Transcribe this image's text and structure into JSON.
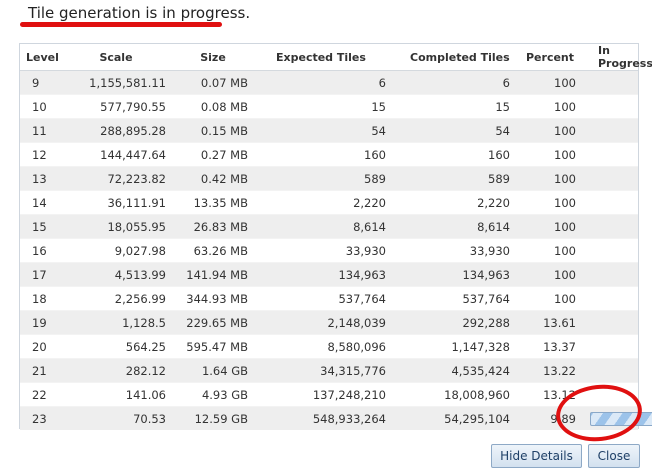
{
  "status_text": "Tile generation is in progress.",
  "columns": {
    "level": "Level",
    "scale": "Scale",
    "size": "Size",
    "expected": "Expected Tiles",
    "completed": "Completed Tiles",
    "percent": "Percent",
    "in_progress": "In Progress"
  },
  "rows": [
    {
      "level": "9",
      "scale": "1,155,581.11",
      "size": "0.07 MB",
      "expected": "6",
      "completed": "6",
      "percent": "100"
    },
    {
      "level": "10",
      "scale": "577,790.55",
      "size": "0.08 MB",
      "expected": "15",
      "completed": "15",
      "percent": "100"
    },
    {
      "level": "11",
      "scale": "288,895.28",
      "size": "0.15 MB",
      "expected": "54",
      "completed": "54",
      "percent": "100"
    },
    {
      "level": "12",
      "scale": "144,447.64",
      "size": "0.27 MB",
      "expected": "160",
      "completed": "160",
      "percent": "100"
    },
    {
      "level": "13",
      "scale": "72,223.82",
      "size": "0.42 MB",
      "expected": "589",
      "completed": "589",
      "percent": "100"
    },
    {
      "level": "14",
      "scale": "36,111.91",
      "size": "13.35 MB",
      "expected": "2,220",
      "completed": "2,220",
      "percent": "100"
    },
    {
      "level": "15",
      "scale": "18,055.95",
      "size": "26.83 MB",
      "expected": "8,614",
      "completed": "8,614",
      "percent": "100"
    },
    {
      "level": "16",
      "scale": "9,027.98",
      "size": "63.26 MB",
      "expected": "33,930",
      "completed": "33,930",
      "percent": "100"
    },
    {
      "level": "17",
      "scale": "4,513.99",
      "size": "141.94 MB",
      "expected": "134,963",
      "completed": "134,963",
      "percent": "100"
    },
    {
      "level": "18",
      "scale": "2,256.99",
      "size": "344.93 MB",
      "expected": "537,764",
      "completed": "537,764",
      "percent": "100"
    },
    {
      "level": "19",
      "scale": "1,128.5",
      "size": "229.65 MB",
      "expected": "2,148,039",
      "completed": "292,288",
      "percent": "13.61"
    },
    {
      "level": "20",
      "scale": "564.25",
      "size": "595.47 MB",
      "expected": "8,580,096",
      "completed": "1,147,328",
      "percent": "13.37"
    },
    {
      "level": "21",
      "scale": "282.12",
      "size": "1.64 GB",
      "expected": "34,315,776",
      "completed": "4,535,424",
      "percent": "13.22"
    },
    {
      "level": "22",
      "scale": "141.06",
      "size": "4.93 GB",
      "expected": "137,248,210",
      "completed": "18,008,960",
      "percent": "13.12"
    },
    {
      "level": "23",
      "scale": "70.53",
      "size": "12.59 GB",
      "expected": "548,933,264",
      "completed": "54,295,104",
      "percent": "9.89"
    }
  ],
  "in_progress_row": 14,
  "buttons": {
    "hide_details": "Hide Details",
    "close": "Close"
  },
  "colors": {
    "annotation": "#e01010",
    "row_alt": "#eeeeee",
    "button_text": "#1e3f66"
  }
}
